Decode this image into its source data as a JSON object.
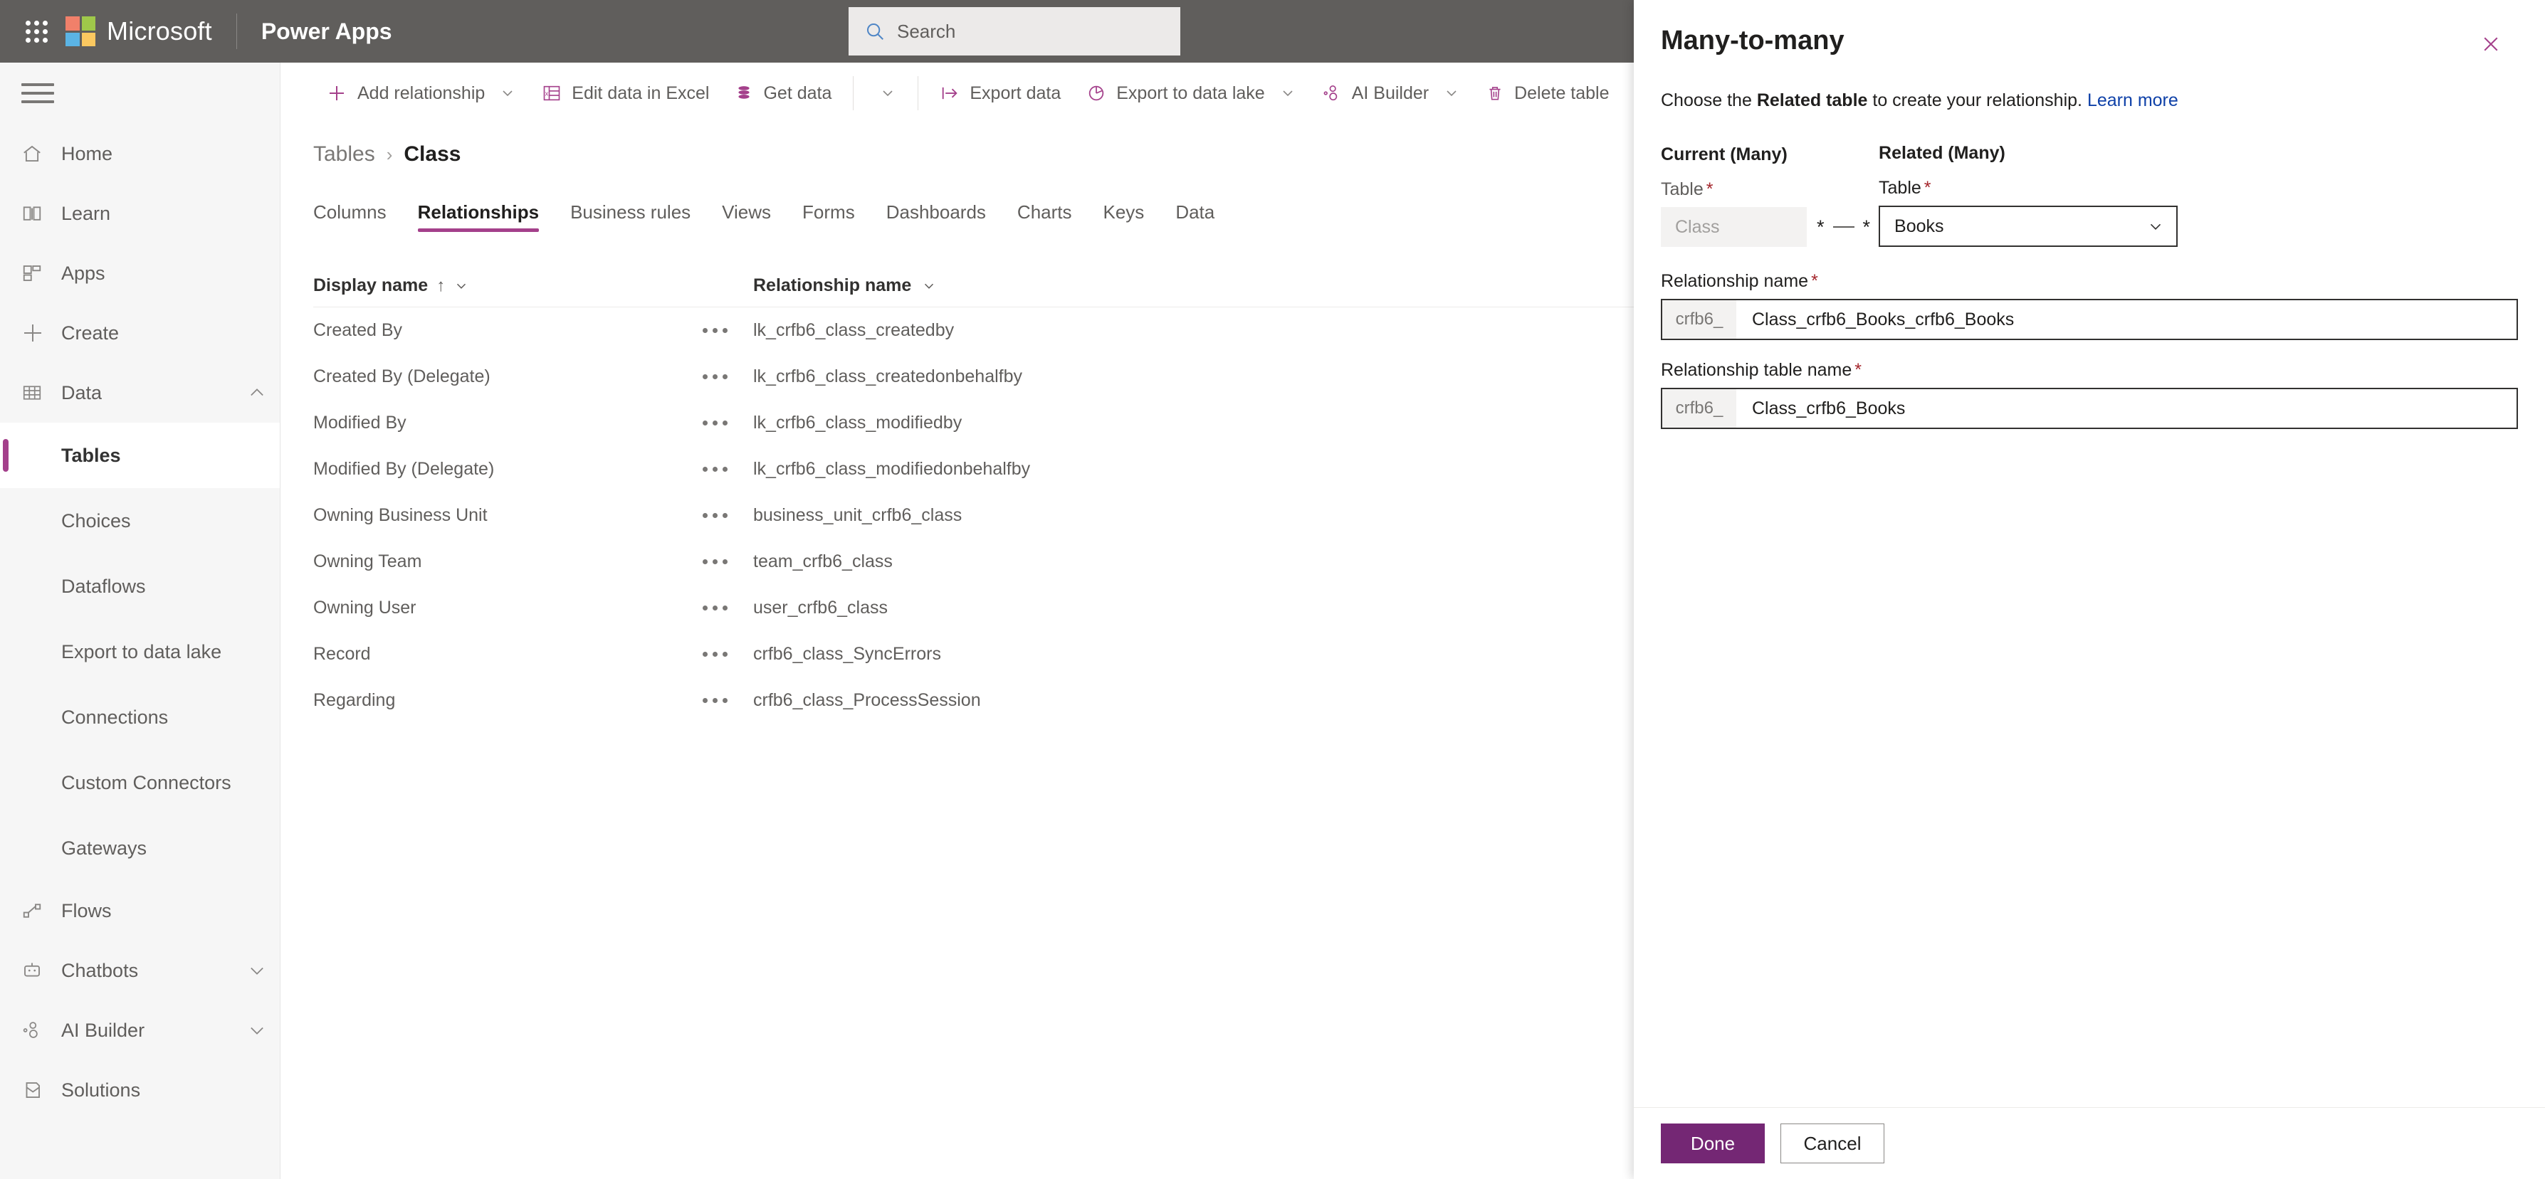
{
  "suitebar": {
    "waffle_label": "App launcher",
    "brand": "Microsoft",
    "app_name": "Power Apps",
    "search_placeholder": "Search"
  },
  "leftnav": {
    "items": [
      {
        "label": "Home",
        "icon": "home-icon",
        "type": "item",
        "chevron": ""
      },
      {
        "label": "Learn",
        "icon": "book-icon",
        "type": "item",
        "chevron": ""
      },
      {
        "label": "Apps",
        "icon": "apps-grid-icon",
        "type": "item",
        "chevron": ""
      },
      {
        "label": "Create",
        "icon": "plus-icon",
        "type": "item",
        "chevron": ""
      },
      {
        "label": "Data",
        "icon": "table-grid-icon",
        "type": "item",
        "chevron": "chevron-up-icon"
      },
      {
        "label": "Tables",
        "icon": "",
        "type": "sub",
        "selected": true
      },
      {
        "label": "Choices",
        "icon": "",
        "type": "sub",
        "selected": false
      },
      {
        "label": "Dataflows",
        "icon": "",
        "type": "sub",
        "selected": false
      },
      {
        "label": "Export to data lake",
        "icon": "",
        "type": "sub",
        "selected": false
      },
      {
        "label": "Connections",
        "icon": "",
        "type": "sub",
        "selected": false
      },
      {
        "label": "Custom Connectors",
        "icon": "",
        "type": "sub",
        "selected": false
      },
      {
        "label": "Gateways",
        "icon": "",
        "type": "sub",
        "selected": false
      },
      {
        "label": "Flows",
        "icon": "flow-icon",
        "type": "item",
        "chevron": ""
      },
      {
        "label": "Chatbots",
        "icon": "bot-icon",
        "type": "item",
        "chevron": "chevron-down-icon"
      },
      {
        "label": "AI Builder",
        "icon": "ai-icon",
        "type": "item",
        "chevron": "chevron-down-icon"
      },
      {
        "label": "Solutions",
        "icon": "solution-icon",
        "type": "item",
        "chevron": ""
      }
    ]
  },
  "commandbar": {
    "buttons": [
      {
        "label": "Add relationship",
        "icon": "plus-icon",
        "chevron": true
      },
      {
        "label": "Edit data in Excel",
        "icon": "excel-icon",
        "chevron": false
      },
      {
        "label": "Get data",
        "icon": "database-icon",
        "chevron": true
      },
      {
        "label": "Export data",
        "icon": "export-icon",
        "chevron": false
      },
      {
        "label": "Export to data lake",
        "icon": "datalake-icon",
        "chevron": false
      },
      {
        "label": "AI Builder",
        "icon": "ai-icon",
        "chevron": true
      },
      {
        "label": "Delete table",
        "icon": "trash-icon",
        "chevron": false
      }
    ]
  },
  "breadcrumb": {
    "parent": "Tables",
    "separator": "›",
    "current": "Class"
  },
  "tabs": [
    {
      "label": "Columns",
      "active": false
    },
    {
      "label": "Relationships",
      "active": true
    },
    {
      "label": "Business rules",
      "active": false
    },
    {
      "label": "Views",
      "active": false
    },
    {
      "label": "Forms",
      "active": false
    },
    {
      "label": "Dashboards",
      "active": false
    },
    {
      "label": "Charts",
      "active": false
    },
    {
      "label": "Keys",
      "active": false
    },
    {
      "label": "Data",
      "active": false
    }
  ],
  "grid": {
    "columns": [
      {
        "key": "display_name",
        "label": "Display name",
        "sorted": true,
        "sort_glyph": "↑"
      },
      {
        "key": "relationship_name",
        "label": "Relationship name",
        "sorted": false,
        "sort_glyph": ""
      }
    ],
    "rows": [
      {
        "display_name": "Created By",
        "relationship_name": "lk_crfb6_class_createdby"
      },
      {
        "display_name": "Created By (Delegate)",
        "relationship_name": "lk_crfb6_class_createdonbehalfby"
      },
      {
        "display_name": "Modified By",
        "relationship_name": "lk_crfb6_class_modifiedby"
      },
      {
        "display_name": "Modified By (Delegate)",
        "relationship_name": "lk_crfb6_class_modifiedonbehalfby"
      },
      {
        "display_name": "Owning Business Unit",
        "relationship_name": "business_unit_crfb6_class"
      },
      {
        "display_name": "Owning Team",
        "relationship_name": "team_crfb6_class"
      },
      {
        "display_name": "Owning User",
        "relationship_name": "user_crfb6_class"
      },
      {
        "display_name": "Record",
        "relationship_name": "crfb6_class_SyncErrors"
      },
      {
        "display_name": "Regarding",
        "relationship_name": "crfb6_class_ProcessSession"
      }
    ]
  },
  "panel": {
    "title": "Many-to-many",
    "close_label": "Close",
    "description_pre": "Choose the ",
    "description_bold": "Related table",
    "description_post": " to create your relationship. ",
    "learn_more": "Learn more",
    "current_group_title": "Current (Many)",
    "current_table_label": "Table",
    "current_table_value": "Class",
    "cardinality_left": "*",
    "cardinality_right": "*",
    "related_group_title": "Related (Many)",
    "related_table_label": "Table",
    "related_table_value": "Books",
    "relationship_name_label": "Relationship name",
    "relationship_name_prefix": "crfb6_",
    "relationship_name_value": "Class_crfb6_Books_crfb6_Books",
    "relationship_table_name_label": "Relationship table name",
    "relationship_table_name_prefix": "crfb6_",
    "relationship_table_name_value": "Class_crfb6_Books",
    "required_marker": "*",
    "done_label": "Done",
    "cancel_label": "Cancel"
  },
  "colors": {
    "accent": "#a4408b",
    "primary_button": "#742774",
    "suitebar": "#605e5c",
    "link": "#0f41a8",
    "required": "#a4262c"
  }
}
